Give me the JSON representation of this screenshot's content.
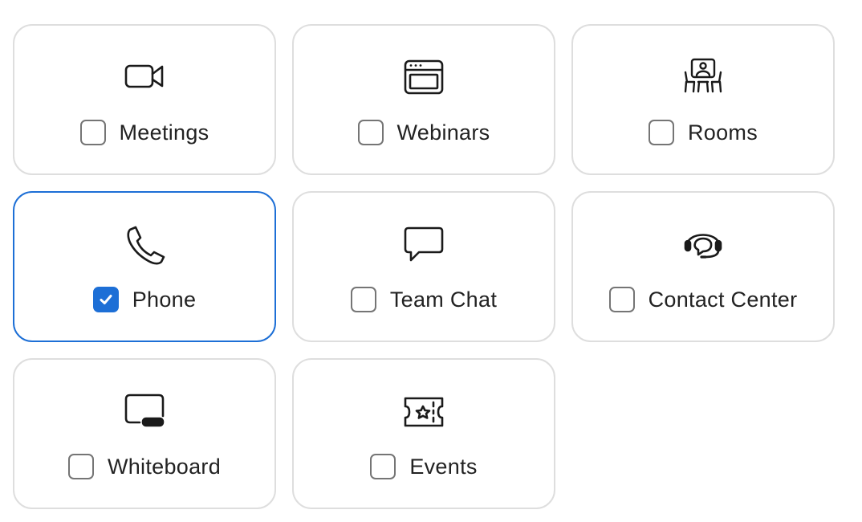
{
  "accent_color": "#1d6fd6",
  "products": [
    {
      "label": "Meetings",
      "icon": "video-camera-icon",
      "checked": false
    },
    {
      "label": "Webinars",
      "icon": "browser-window-icon",
      "checked": false
    },
    {
      "label": "Rooms",
      "icon": "conference-room-icon",
      "checked": false
    },
    {
      "label": "Phone",
      "icon": "phone-icon",
      "checked": true
    },
    {
      "label": "Team Chat",
      "icon": "chat-bubble-icon",
      "checked": false
    },
    {
      "label": "Contact Center",
      "icon": "headset-icon",
      "checked": false
    },
    {
      "label": "Whiteboard",
      "icon": "whiteboard-icon",
      "checked": false
    },
    {
      "label": "Events",
      "icon": "event-ticket-icon",
      "checked": false
    }
  ]
}
